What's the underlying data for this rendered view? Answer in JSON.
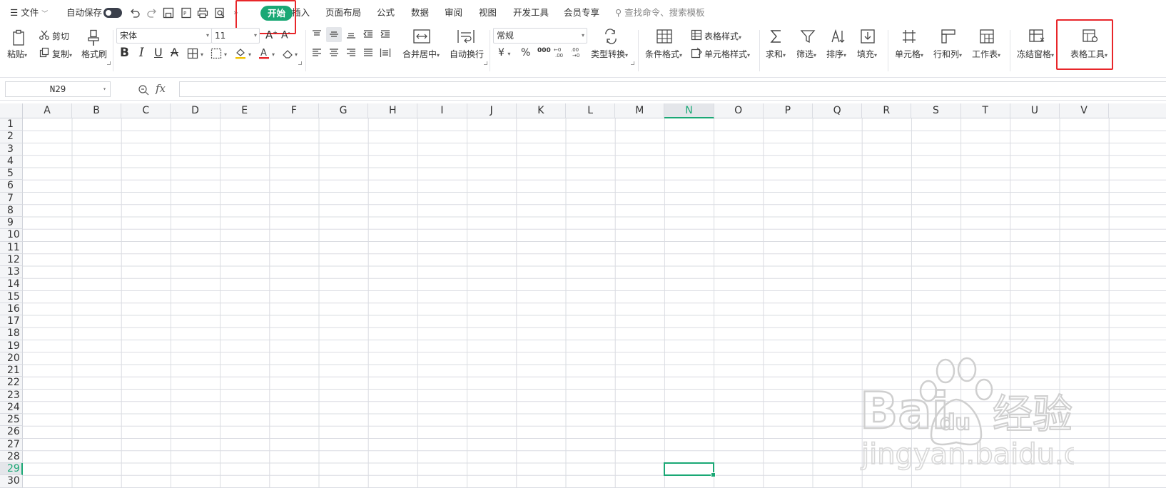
{
  "menubar": {
    "file": "文件",
    "autosave": "自动保存",
    "tabs": [
      "开始",
      "插入",
      "页面布局",
      "公式",
      "数据",
      "审阅",
      "视图",
      "开发工具",
      "会员专享"
    ],
    "search_placeholder": "查找命令、搜索模板"
  },
  "ribbon": {
    "paste": "粘贴",
    "cut": "剪切",
    "copy": "复制",
    "format_painter": "格式刷",
    "font_name": "宋体",
    "font_size": "11",
    "bold": "B",
    "italic": "I",
    "underline": "U",
    "strike": "A",
    "grow_font": "A",
    "shrink_font": "A",
    "merge_center": "合并居中",
    "wrap_text": "自动换行",
    "number_format": "常规",
    "currency": "¥",
    "percent": "%",
    "thousands": "000",
    "type_convert": "类型转换",
    "cond_format": "条件格式",
    "table_style": "表格样式",
    "cell_style": "单元格样式",
    "sum": "求和",
    "filter": "筛选",
    "sort": "排序",
    "fill": "填充",
    "cell": "单元格",
    "row_col": "行和列",
    "worksheet": "工作表",
    "freeze": "冻结窗格",
    "table_tools": "表格工具"
  },
  "formula_bar": {
    "cell_ref": "N29",
    "fx": "fx",
    "formula": ""
  },
  "sheet": {
    "columns": [
      "A",
      "B",
      "C",
      "D",
      "E",
      "F",
      "G",
      "H",
      "I",
      "J",
      "K",
      "L",
      "M",
      "N",
      "O",
      "P",
      "Q",
      "R",
      "S",
      "T",
      "U",
      "V"
    ],
    "rows": [
      "1",
      "2",
      "3",
      "4",
      "5",
      "6",
      "7",
      "8",
      "9",
      "10",
      "11",
      "12",
      "13",
      "14",
      "15",
      "16",
      "17",
      "18",
      "19",
      "20",
      "21",
      "22",
      "23",
      "24",
      "25",
      "26",
      "27",
      "28",
      "29",
      "30"
    ],
    "active_column": "N",
    "active_row": "29"
  },
  "watermark": {
    "brand": "Bai",
    "brand2": "du",
    "brand_cn": "经验",
    "url": "jingyan.baidu.com"
  },
  "colors": {
    "accent": "#1aa875",
    "highlight_box": "#e8262a",
    "gridline": "#dadce2"
  }
}
